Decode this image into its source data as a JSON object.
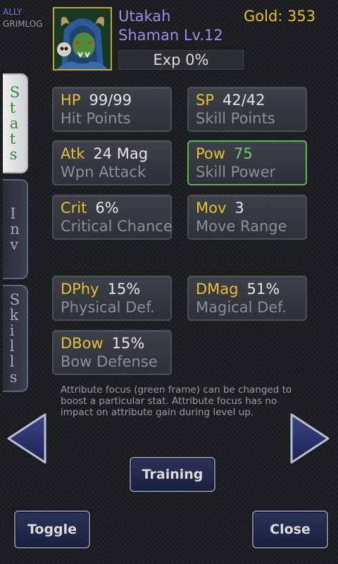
{
  "header": {
    "faction_label": "ALLY",
    "player_label": "GRIMLOG",
    "character_name": "Utakah",
    "class_level": "Shaman Lv.12",
    "gold": "Gold: 353",
    "exp_text": "Exp 0%",
    "exp_fraction": 0
  },
  "tabs": [
    {
      "label": "Stats",
      "active": true
    },
    {
      "label": "Inv",
      "active": false
    },
    {
      "label": "Skills",
      "active": false
    }
  ],
  "stats": {
    "hp": {
      "abbr": "HP",
      "value": "99/99",
      "label": "Hit Points"
    },
    "sp": {
      "abbr": "SP",
      "value": "42/42",
      "label": "Skill Points"
    },
    "atk": {
      "abbr": "Atk",
      "value": "24 Mag",
      "label": "Wpn Attack"
    },
    "pow": {
      "abbr": "Pow",
      "value": "75",
      "label": "Skill Power",
      "focused": true
    },
    "crit": {
      "abbr": "Crit",
      "value": "6%",
      "label": "Critical Chance"
    },
    "mov": {
      "abbr": "Mov",
      "value": "3",
      "label": "Move Range"
    },
    "dphy": {
      "abbr": "DPhy",
      "value": "15%",
      "label": "Physical Def."
    },
    "dmag": {
      "abbr": "DMag",
      "value": "51%",
      "label": "Magical Def."
    },
    "dbow": {
      "abbr": "DBow",
      "value": "15%",
      "label": "Bow Defense"
    }
  },
  "note": "Attribute focus (green frame) can be changed to boost a particular stat. Attribute focus has no impact on attribute gain during level up.",
  "buttons": {
    "training": "Training",
    "toggle": "Toggle",
    "close": "Close"
  },
  "icons": {
    "prev": "left-arrow-icon",
    "next": "right-arrow-icon",
    "portrait": "orc-shaman-portrait"
  },
  "colors": {
    "gold_text": "#e8c034",
    "name_text": "#9a8fe8",
    "focus_frame": "#58b55a",
    "button_fill": "#1f2547"
  }
}
